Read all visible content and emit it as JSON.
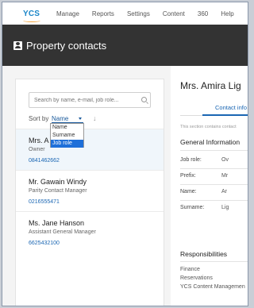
{
  "nav": {
    "logo": "YCS",
    "links": [
      "Manage",
      "Reports",
      "Settings",
      "Content",
      "360",
      "Help"
    ]
  },
  "header": {
    "title": "Property contacts"
  },
  "search": {
    "placeholder": "Search by name, e-mail, job role..."
  },
  "sort": {
    "label": "Sort by",
    "selected": "Name",
    "options": [
      "Name",
      "Surname",
      "Job role"
    ],
    "highlighted_option": "Job role"
  },
  "contacts": [
    {
      "name": "Mrs. Amira Lightfoot",
      "name_visible": "Mrs. A",
      "role": "Owner",
      "phone": "0841462662"
    },
    {
      "name": "Mr. Gawain Windy",
      "role": "Parity Contact Manager",
      "phone": "0216555471"
    },
    {
      "name": "Ms. Jane Hanson",
      "role": "Assistant General Manager",
      "phone": "6625432100"
    }
  ],
  "detail": {
    "name": "Mrs. Amira Lig",
    "tab": "Contact info",
    "note": "This section contains contact",
    "general_title": "General Information",
    "fields": [
      {
        "label": "Job role:",
        "value": "Ov"
      },
      {
        "label": "Prefix:",
        "value": "Mr"
      },
      {
        "label": "Name:",
        "value": "Ar"
      },
      {
        "label": "Surname:",
        "value": "Lig"
      }
    ],
    "responsibilities_title": "Responsibilities",
    "responsibilities": [
      "Finance",
      "Reservations",
      "YCS Content Managemen"
    ]
  },
  "colors": {
    "accent": "#1a66b3",
    "header_band": "#333333",
    "selected_option": "#1e6fd9",
    "logo": "#1a86c8",
    "logo_swoosh": "#f2a33a"
  }
}
